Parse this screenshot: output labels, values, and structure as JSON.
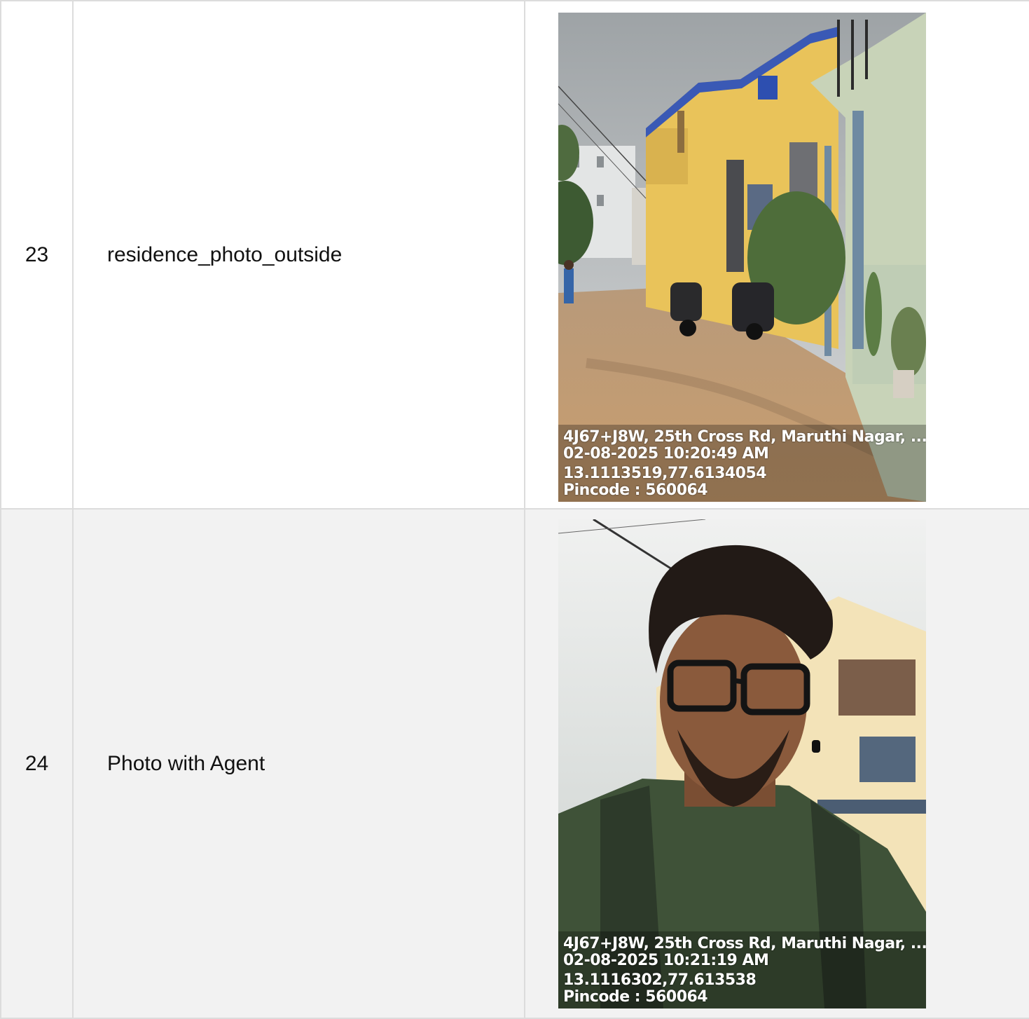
{
  "rows": [
    {
      "number": "23",
      "label": "residence_photo_outside",
      "photo": {
        "subject": "residence exterior street view",
        "address": "4J67+J8W, 25th Cross Rd, Maruthi Nagar, ...",
        "datetime": "02-08-2025 10:20:49 AM",
        "coordinates": "13.1113519,77.6134054",
        "pincode": "Pincode : 560064"
      }
    },
    {
      "number": "24",
      "label": "Photo with Agent",
      "photo": {
        "subject": "selfie of agent in front of building",
        "address": "4J67+J8W, 25th Cross Rd, Maruthi Nagar, ...",
        "datetime": "02-08-2025 10:21:19 AM",
        "coordinates": "13.1116302,77.613538",
        "pincode": "Pincode : 560064"
      }
    }
  ],
  "colors": {
    "border": "#dcdcdc",
    "alt_row": "#f2f2f2",
    "wall_yellow": "#e9c35a",
    "shirt_green": "#3f5238"
  }
}
